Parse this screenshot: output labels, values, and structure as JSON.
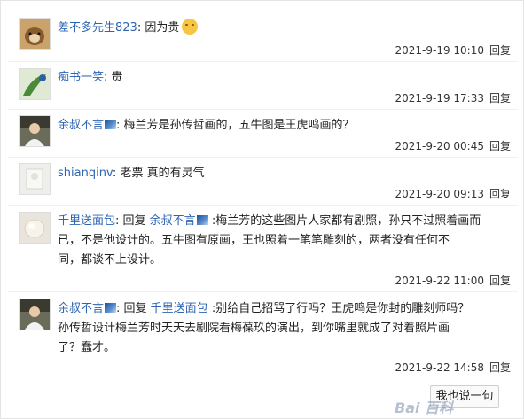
{
  "comments": [
    {
      "user": "差不多先生823",
      "sep": ":",
      "text": " 因为贵",
      "emoji": "smile-icon",
      "time": "2021-9-19 10:10",
      "reply": "回复"
    },
    {
      "user": "痴书一笑",
      "sep": ":",
      "text": " 贵",
      "time": "2021-9-19 17:33",
      "reply": "回复"
    },
    {
      "user": "余叔不言",
      "sep": ":",
      "text": " 梅兰芳是孙传哲画的，五牛图是王虎鸣画的？",
      "time": "2021-9-20 00:45",
      "reply": "回复"
    },
    {
      "user": "shianqinv",
      "sep": ":",
      "text": " 老票 真的有灵气",
      "time": "2021-9-20 09:13",
      "reply": "回复"
    },
    {
      "user": "千里送面包",
      "sep": ":",
      "reply_word": " 回复 ",
      "reply_to": "余叔不言",
      "text_line1": " :梅兰芳的这些图片人家都有剧照，孙只不过照着画而",
      "text_line2": "已，不是他设计的。五牛图有原画，王也照着一笔笔雕刻的，两者没有任何不",
      "text_line3": "同，都谈不上设计。",
      "time": "2021-9-22 11:00",
      "reply": "回复"
    },
    {
      "user": "余叔不言",
      "sep": ":",
      "reply_word": " 回复 ",
      "reply_to": "千里送面包",
      "text_line1": " :别给自己招骂了行吗？王虎鸣是你封的雕刻师吗？",
      "text_line2": "孙传哲设计梅兰芳时天天去剧院看梅葆玖的演出，到你嘴里就成了对着照片画",
      "text_line3": "了？蠢才。",
      "time": "2021-9-22 14:58",
      "reply": "回复"
    }
  ],
  "reply_button": "我也说一句",
  "watermark": "Bai 百科"
}
